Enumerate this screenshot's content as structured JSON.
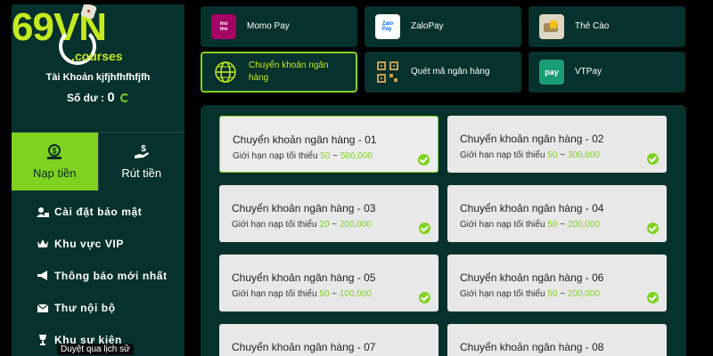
{
  "logo": {
    "brand": "69VN",
    "sub": ".courses"
  },
  "account": {
    "label": "Tài Khoản kjfjhfhfhfjfh",
    "balance_label": "Số dư :",
    "balance_value": "0"
  },
  "tabs": [
    {
      "label": "Nạp tiền",
      "icon": "deposit-icon",
      "active": true
    },
    {
      "label": "Rút tiền",
      "icon": "withdraw-icon",
      "active": false
    }
  ],
  "menu": [
    {
      "label": "Cài đặt bảo mật",
      "icon": "user-lock-icon"
    },
    {
      "label": "Khu vực VIP",
      "icon": "crown-icon"
    },
    {
      "label": "Thông báo mới nhất",
      "icon": "megaphone-icon"
    },
    {
      "label": "Thư nội bộ",
      "icon": "envelope-icon"
    },
    {
      "label": "Khu sự kiện",
      "icon": "trophy-icon"
    }
  ],
  "tooltip": "Duyệt qua lịch sử",
  "methods": [
    {
      "label": "Momo Pay",
      "icon": "momo-icon",
      "active": false
    },
    {
      "label": "ZaloPay",
      "icon": "zalopay-icon",
      "active": false
    },
    {
      "label": "Thẻ Cào",
      "icon": "card-icon",
      "active": false
    },
    {
      "label": "Chuyển khoản ngân hàng",
      "icon": "globe-icon",
      "active": true
    },
    {
      "label": "Quét mã ngân hàng",
      "icon": "qr-icon",
      "active": false
    },
    {
      "label": "VTPay",
      "icon": "vtpay-icon",
      "active": false
    }
  ],
  "limit_label": "Giới hạn nạp tối thiểu",
  "banks": [
    {
      "title": "Chuyển khoản ngân hàng - 01",
      "min": "50",
      "max": "500,000",
      "selected": true
    },
    {
      "title": "Chuyển khoản ngân hàng - 02",
      "min": "50",
      "max": "300,000",
      "selected": false
    },
    {
      "title": "Chuyển khoản ngân hàng - 03",
      "min": "20",
      "max": "200,000",
      "selected": false
    },
    {
      "title": "Chuyển khoản ngân hàng - 04",
      "min": "50",
      "max": "200,000",
      "selected": false
    },
    {
      "title": "Chuyển khoản ngân hàng - 05",
      "min": "50",
      "max": "100,000",
      "selected": false
    },
    {
      "title": "Chuyển khoản ngân hàng - 06",
      "min": "50",
      "max": "200,000",
      "selected": false
    },
    {
      "title": "Chuyển khoản ngân hàng - 07",
      "min": "",
      "max": "",
      "selected": false
    },
    {
      "title": "Chuyển khoản ngân hàng - 08",
      "min": "",
      "max": "",
      "selected": false
    }
  ],
  "colors": {
    "accent": "#7ed321",
    "panel": "#07312c",
    "brand_yellow": "#c5ea1f"
  }
}
